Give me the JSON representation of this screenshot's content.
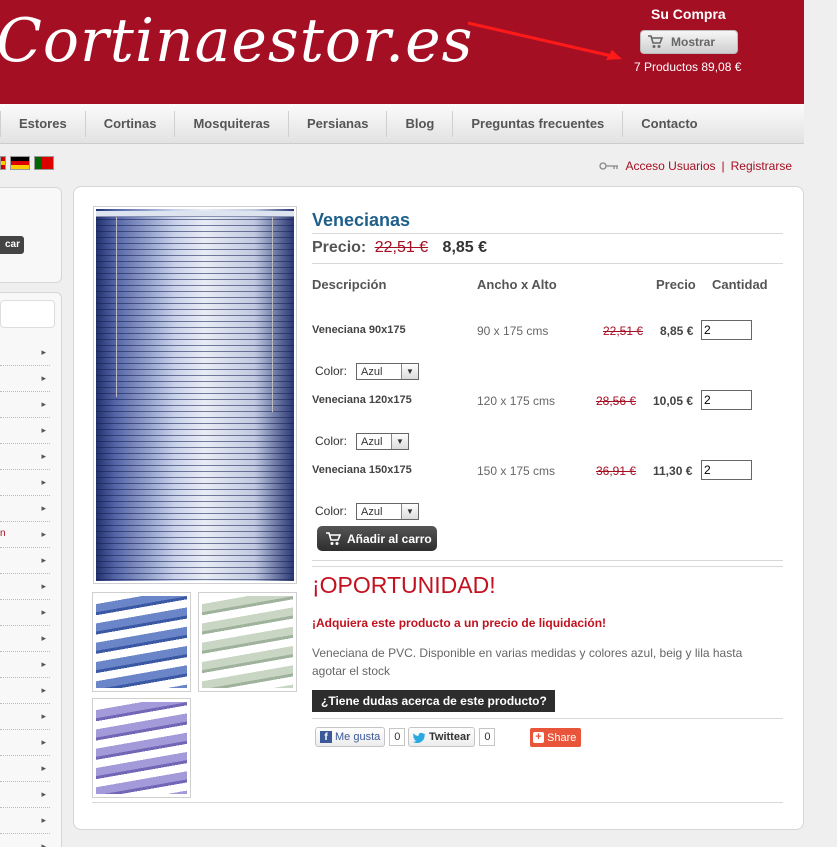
{
  "header": {
    "logo": "Cortinaestor.es",
    "cart_title": "Su Compra",
    "cart_button": "Mostrar",
    "cart_summary": "7 Productos 89,08 €",
    "brand_color": "#a50f23"
  },
  "nav": {
    "items": [
      "Estores",
      "Cortinas",
      "Mosquiteras",
      "Persianas",
      "Blog",
      "Preguntas frecuentes",
      "Contacto"
    ]
  },
  "login": {
    "access": "Acceso Usuarios",
    "separator": "|",
    "register": "Registrarse"
  },
  "sidebar": {
    "search_button": "car",
    "fragment": "n"
  },
  "product": {
    "title": "Venecianas",
    "price_label": "Precio:",
    "old_price": "22,51 €",
    "new_price": "8,85 €",
    "table_headers": {
      "description": "Descripción",
      "size": "Ancho x Alto",
      "price": "Precio",
      "quantity": "Cantidad"
    },
    "variants": [
      {
        "name": "Veneciana 90x175",
        "size": "90 x 175 cms",
        "old_price": "22,51 €",
        "new_price": "8,85 €",
        "quantity": "2",
        "color_label": "Color:",
        "color": "Azul"
      },
      {
        "name": "Veneciana 120x175",
        "size": "120 x 175 cms",
        "old_price": "28,56 €",
        "new_price": "10,05 €",
        "quantity": "2",
        "color_label": "Color:",
        "color": "Azul"
      },
      {
        "name": "Veneciana 150x175",
        "size": "150 x 175 cms",
        "old_price": "36,91 €",
        "new_price": "11,30 €",
        "quantity": "2",
        "color_label": "Color:",
        "color": "Azul"
      }
    ],
    "add_to_cart": "Añadir al carro",
    "opportunity_title": "¡OPORTUNIDAD!",
    "opportunity_subtitle": "¡Adquiera este producto a un precio de liquidación!",
    "description": "Veneciana de PVC. Disponible en varias medidas y colores azul, beig y lila hasta agotar el stock",
    "question_button": "¿Tiene dudas acerca de este producto?"
  },
  "social": {
    "like": "Me gusta",
    "like_count": "0",
    "tweet": "Twittear",
    "tweet_count": "0",
    "share": "Share"
  }
}
